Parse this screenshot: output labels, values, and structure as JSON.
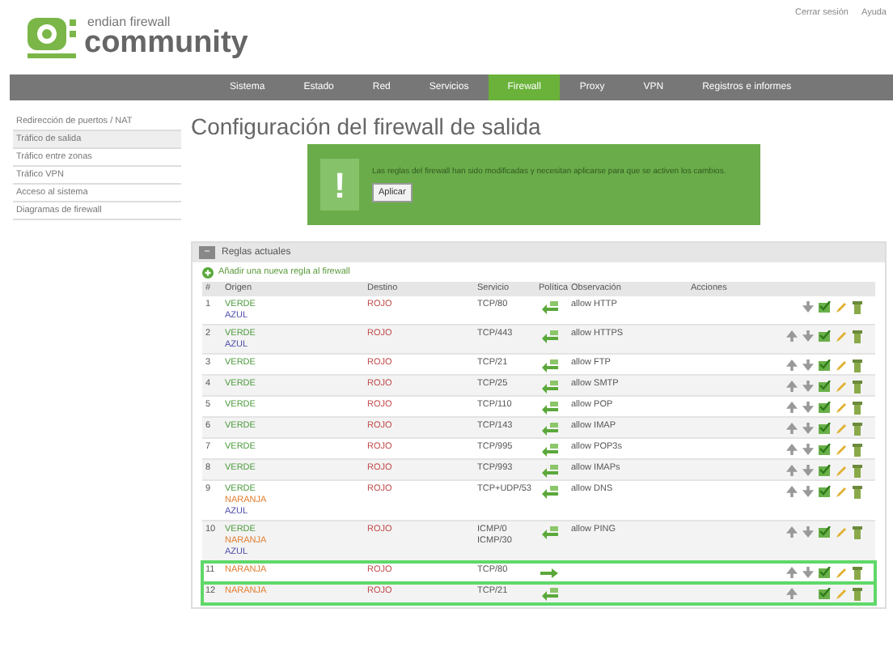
{
  "header": {
    "logo_top": "endian firewall",
    "logo_bottom": "community",
    "links": [
      "Cerrar sesión",
      "Ayuda"
    ]
  },
  "nav": [
    {
      "label": "Sistema",
      "selected": false
    },
    {
      "label": "Estado",
      "selected": false
    },
    {
      "label": "Red",
      "selected": false
    },
    {
      "label": "Servicios",
      "selected": false
    },
    {
      "label": "Firewall",
      "selected": true
    },
    {
      "label": "Proxy",
      "selected": false
    },
    {
      "label": "VPN",
      "selected": false
    },
    {
      "label": "Registros e informes",
      "selected": false
    }
  ],
  "sidebar": [
    {
      "label": "Redirección de puertos / NAT",
      "selected": false
    },
    {
      "label": "Tráfico de salida",
      "selected": true
    },
    {
      "label": "Tráfico entre zonas",
      "selected": false
    },
    {
      "label": "Tráfico VPN",
      "selected": false
    },
    {
      "label": "Acceso al sistema",
      "selected": false
    },
    {
      "label": "Diagramas de firewall",
      "selected": false
    }
  ],
  "title": "Configuración del firewall de salida",
  "notice": {
    "icon": "!",
    "text": "Las reglas del firewall han sido modificadas y necesitan aplicarse para que se activen los cambios.",
    "button": "Aplicar"
  },
  "panel": {
    "toggle": "−",
    "title": "Reglas actuales",
    "add_link": "Añadir una nueva regla al firewall",
    "columns": [
      "#",
      "Origen",
      "Destino",
      "Servicio",
      "Política",
      "Observación",
      "Acciones"
    ],
    "rows": [
      {
        "num": "1",
        "origin": [
          {
            "name": "VERDE",
            "color": "#4a9a3a"
          },
          {
            "name": "AZUL",
            "color": "#4a4aa8"
          }
        ],
        "dest": "ROJO",
        "service": [
          "TCP/80"
        ],
        "policy": {
          "kind": "allow"
        },
        "note": "allow HTTP",
        "move_up": false,
        "move_down": true,
        "highlighted": false
      },
      {
        "num": "2",
        "origin": [
          {
            "name": "VERDE",
            "color": "#4a9a3a"
          },
          {
            "name": "AZUL",
            "color": "#4a4aa8"
          }
        ],
        "dest": "ROJO",
        "service": [
          "TCP/443"
        ],
        "policy": {
          "kind": "allow"
        },
        "note": "allow HTTPS",
        "move_up": true,
        "move_down": true,
        "highlighted": false
      },
      {
        "num": "3",
        "origin": [
          {
            "name": "VERDE",
            "color": "#4a9a3a"
          }
        ],
        "dest": "ROJO",
        "service": [
          "TCP/21"
        ],
        "policy": {
          "kind": "allow"
        },
        "note": "allow FTP",
        "move_up": true,
        "move_down": true,
        "highlighted": false
      },
      {
        "num": "4",
        "origin": [
          {
            "name": "VERDE",
            "color": "#4a9a3a"
          }
        ],
        "dest": "ROJO",
        "service": [
          "TCP/25"
        ],
        "policy": {
          "kind": "allow"
        },
        "note": "allow SMTP",
        "move_up": true,
        "move_down": true,
        "highlighted": false
      },
      {
        "num": "5",
        "origin": [
          {
            "name": "VERDE",
            "color": "#4a9a3a"
          }
        ],
        "dest": "ROJO",
        "service": [
          "TCP/110"
        ],
        "policy": {
          "kind": "allow"
        },
        "note": "allow POP",
        "move_up": true,
        "move_down": true,
        "highlighted": false
      },
      {
        "num": "6",
        "origin": [
          {
            "name": "VERDE",
            "color": "#4a9a3a"
          }
        ],
        "dest": "ROJO",
        "service": [
          "TCP/143"
        ],
        "policy": {
          "kind": "allow"
        },
        "note": "allow IMAP",
        "move_up": true,
        "move_down": true,
        "highlighted": false
      },
      {
        "num": "7",
        "origin": [
          {
            "name": "VERDE",
            "color": "#4a9a3a"
          }
        ],
        "dest": "ROJO",
        "service": [
          "TCP/995"
        ],
        "policy": {
          "kind": "allow"
        },
        "note": "allow POP3s",
        "move_up": true,
        "move_down": true,
        "highlighted": false
      },
      {
        "num": "8",
        "origin": [
          {
            "name": "VERDE",
            "color": "#4a9a3a"
          }
        ],
        "dest": "ROJO",
        "service": [
          "TCP/993"
        ],
        "policy": {
          "kind": "allow"
        },
        "note": "allow IMAPs",
        "move_up": true,
        "move_down": true,
        "highlighted": false
      },
      {
        "num": "9",
        "origin": [
          {
            "name": "VERDE",
            "color": "#4a9a3a"
          },
          {
            "name": "NARANJA",
            "color": "#e07a2a"
          },
          {
            "name": "AZUL",
            "color": "#4a4aa8"
          }
        ],
        "dest": "ROJO",
        "service": [
          "TCP+UDP/53"
        ],
        "policy": {
          "kind": "allow"
        },
        "note": "allow DNS",
        "move_up": true,
        "move_down": true,
        "highlighted": false
      },
      {
        "num": "10",
        "origin": [
          {
            "name": "VERDE",
            "color": "#4a9a3a"
          },
          {
            "name": "NARANJA",
            "color": "#e07a2a"
          },
          {
            "name": "AZUL",
            "color": "#4a4aa8"
          }
        ],
        "dest": "ROJO",
        "service": [
          "ICMP/0",
          "ICMP/30"
        ],
        "policy": {
          "kind": "allow"
        },
        "note": "allow PING",
        "move_up": true,
        "move_down": true,
        "highlighted": false
      },
      {
        "num": "11",
        "origin": [
          {
            "name": "NARANJA",
            "color": "#e07a2a"
          }
        ],
        "dest": "ROJO",
        "service": [
          "TCP/80"
        ],
        "policy": {
          "kind": "forward"
        },
        "move_up": true,
        "move_down": true,
        "highlighted": true
      },
      {
        "num": "12",
        "origin": [
          {
            "name": "NARANJA",
            "color": "#e07a2a"
          }
        ],
        "dest": "ROJO",
        "service": [
          "TCP/21"
        ],
        "policy": {
          "kind": "allow"
        },
        "move_up": true,
        "move_down": false,
        "highlighted": true
      }
    ]
  }
}
